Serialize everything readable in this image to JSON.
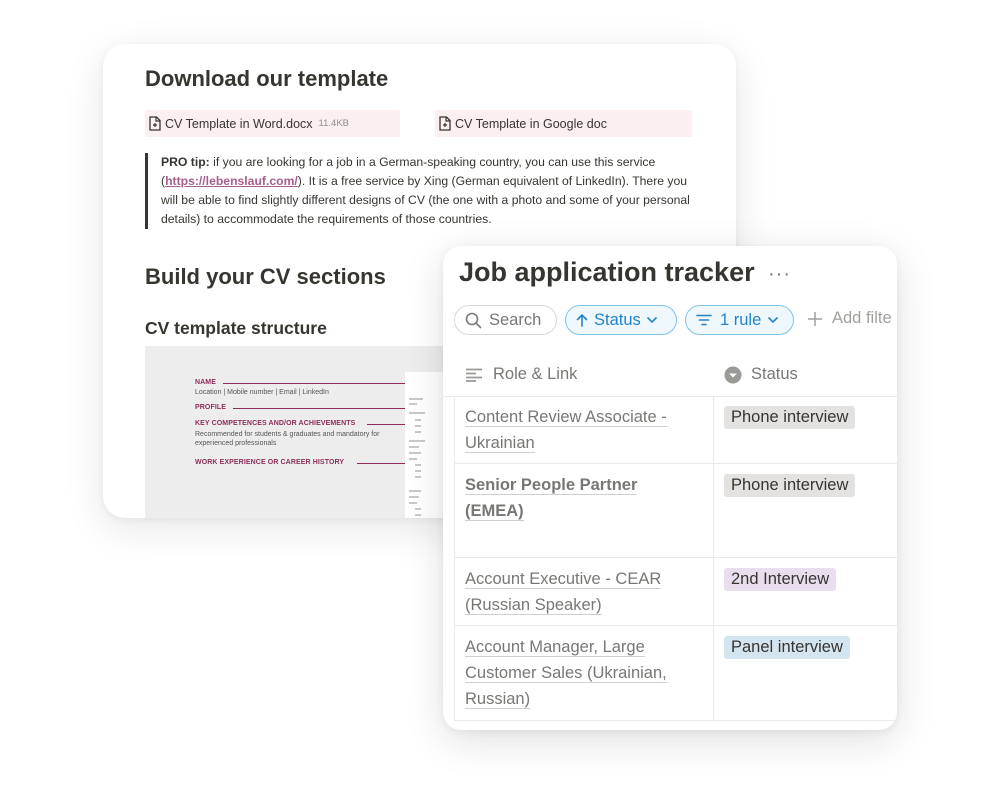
{
  "download": {
    "heading": "Download our template",
    "files": [
      {
        "name": "CV Template in Word.docx",
        "size": "11.4KB"
      },
      {
        "name": "CV Template in Google doc",
        "size": ""
      }
    ]
  },
  "protip": {
    "label": "PRO tip:",
    "text1": " if you are looking for a job in a German-speaking country, you can use this service (",
    "link": "https://lebenslauf.com/",
    "text2": "). It is a free service by Xing (German equivalent of LinkedIn). There you will be able to find slightly different designs of CV (the one with a photo and some of your personal details) to accommodate the requirements of those countries."
  },
  "sections": {
    "heading": "Build your CV sections",
    "subheading": "CV template structure"
  },
  "cv_preview": {
    "name_label": "NAME",
    "name_sub": "Location | Mobile number | Email | LinkedIn",
    "profile_label": "PROFILE",
    "competences_label": "KEY COMPETENCES AND/OR ACHIEVEMENTS",
    "competences_sub1": "Recommended for students & graduates and mandatory for",
    "competences_sub2": "experienced professionals",
    "experience_label": "WORK EXPERIENCE OR CAREER HISTORY"
  },
  "tracker": {
    "title": "Job application tracker",
    "more": "···",
    "search_label": "Search",
    "status_filter": "Status",
    "rule_filter": "1 rule",
    "add_filter": "Add filte",
    "col_role": "Role & Link",
    "col_status": "Status",
    "rows": [
      {
        "role": [
          "Content Review Associate -",
          "Ukrainian"
        ],
        "status": "Phone interview",
        "status_color": "#e3e2e0"
      },
      {
        "role": [
          "Senior People Partner",
          "(EMEA)"
        ],
        "status": "Phone interview",
        "status_color": "#e3e2e0"
      },
      {
        "role": [
          "Account Executive - CEAR",
          "(Russian Speaker)"
        ],
        "status": "2nd Interview",
        "status_color": "#e8deee"
      },
      {
        "role": [
          "Account Manager, Large",
          "Customer Sales (Ukrainian,",
          "Russian)"
        ],
        "status": "Panel interview",
        "status_color": "#d3e5ef"
      }
    ]
  }
}
